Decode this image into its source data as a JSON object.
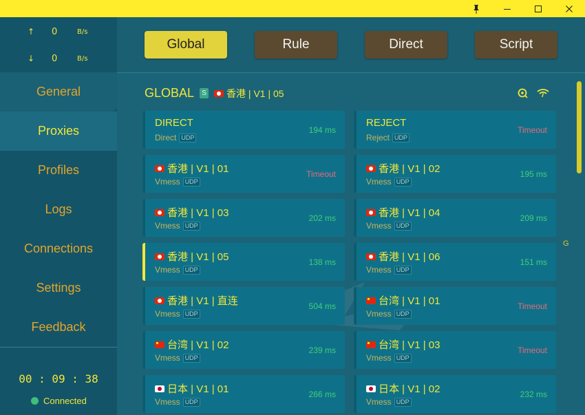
{
  "window": {
    "pin_icon": "pin-icon",
    "minimize_icon": "minimize-icon",
    "maximize_icon": "maximize-icon",
    "close_icon": "close-icon"
  },
  "traffic": {
    "up_arrow": "↑",
    "up_value": "0",
    "up_unit": "B/s",
    "down_arrow": "↓",
    "down_value": "0",
    "down_unit": "B/s"
  },
  "nav": {
    "items": [
      {
        "label": "General"
      },
      {
        "label": "Proxies"
      },
      {
        "label": "Profiles"
      },
      {
        "label": "Logs"
      },
      {
        "label": "Connections"
      },
      {
        "label": "Settings"
      },
      {
        "label": "Feedback"
      }
    ],
    "active": "Proxies"
  },
  "status": {
    "timer": "00 : 09 : 38",
    "connection": "Connected"
  },
  "modes": {
    "items": [
      {
        "label": "Global"
      },
      {
        "label": "Rule"
      },
      {
        "label": "Direct"
      },
      {
        "label": "Script"
      }
    ],
    "active": "Global"
  },
  "group": {
    "name": "GLOBAL",
    "badge": "S",
    "selected": "香港 | V1 | 05",
    "side_letter": "G"
  },
  "proxies": [
    {
      "name": "DIRECT",
      "type": "Direct",
      "udp": "UDP",
      "delay": "194 ms",
      "flag": ""
    },
    {
      "name": "REJECT",
      "type": "Reject",
      "udp": "UDP",
      "delay": "Timeout",
      "flag": ""
    },
    {
      "name": "香港 | V1 | 01",
      "type": "Vmess",
      "udp": "UDP",
      "delay": "Timeout",
      "flag": "hk"
    },
    {
      "name": "香港 | V1 | 02",
      "type": "Vmess",
      "udp": "UDP",
      "delay": "195 ms",
      "flag": "hk"
    },
    {
      "name": "香港 | V1 | 03",
      "type": "Vmess",
      "udp": "UDP",
      "delay": "202 ms",
      "flag": "hk"
    },
    {
      "name": "香港 | V1 | 04",
      "type": "Vmess",
      "udp": "UDP",
      "delay": "209 ms",
      "flag": "hk"
    },
    {
      "name": "香港 | V1 | 05",
      "type": "Vmess",
      "udp": "UDP",
      "delay": "138 ms",
      "flag": "hk"
    },
    {
      "name": "香港 | V1 | 06",
      "type": "Vmess",
      "udp": "UDP",
      "delay": "151 ms",
      "flag": "hk"
    },
    {
      "name": "香港 | V1 | 直连",
      "type": "Vmess",
      "udp": "UDP",
      "delay": "504 ms",
      "flag": "hk"
    },
    {
      "name": "台湾 | V1 | 01",
      "type": "Vmess",
      "udp": "UDP",
      "delay": "Timeout",
      "flag": "cn"
    },
    {
      "name": "台湾 | V1 | 02",
      "type": "Vmess",
      "udp": "UDP",
      "delay": "239 ms",
      "flag": "cn"
    },
    {
      "name": "台湾 | V1 | 03",
      "type": "Vmess",
      "udp": "UDP",
      "delay": "Timeout",
      "flag": "cn"
    },
    {
      "name": "日本 | V1 | 01",
      "type": "Vmess",
      "udp": "UDP",
      "delay": "266 ms",
      "flag": "jp"
    },
    {
      "name": "日本 | V1 | 02",
      "type": "Vmess",
      "udp": "UDP",
      "delay": "232 ms",
      "flag": "jp"
    }
  ],
  "colors": {
    "accent": "#f3e63a",
    "titlebar": "#ffed2b",
    "delay_ok": "#3fcf7a",
    "delay_timeout": "#e56a7b"
  }
}
